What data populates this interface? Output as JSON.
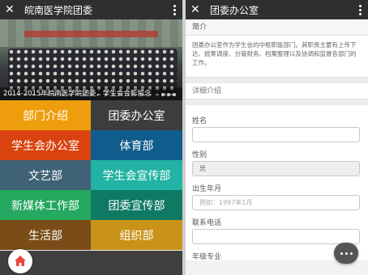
{
  "left": {
    "title": "皖南医学院团委",
    "banner_caption": "2014-2015年皖南医学院团委，学生会合影留念",
    "tiles": [
      {
        "label": "部门介绍",
        "color": "#ee9d0c"
      },
      {
        "label": "团委办公室",
        "color": "#3d3d3d"
      },
      {
        "label": "学生会办公室",
        "color": "#d9430f"
      },
      {
        "label": "体育部",
        "color": "#0f5d8c"
      },
      {
        "label": "文艺部",
        "color": "#3f6276"
      },
      {
        "label": "学生会宣传部",
        "color": "#22b3a4"
      },
      {
        "label": "新媒体工作部",
        "color": "#25a85f"
      },
      {
        "label": "团委宣传部",
        "color": "#0e7a64"
      },
      {
        "label": "生活部",
        "color": "#7a4d18"
      },
      {
        "label": "组织部",
        "color": "#c99319"
      }
    ]
  },
  "right": {
    "title": "团委办公室",
    "intro_header": "简介",
    "intro_text": "团委办公室作为学生会的中枢职能部门。其职责主要有上传下达、统筹调度、分管财务、档案整理以及协调和监督各部门的工作。",
    "detail_header": "详细介绍",
    "fields": {
      "name_label": "姓名",
      "gender_label": "性别",
      "gender_value": "男",
      "birth_label": "出生年月",
      "birth_placeholder": "例如：1997年1月",
      "phone_label": "联系电话",
      "grade_label": "年级专业"
    }
  }
}
